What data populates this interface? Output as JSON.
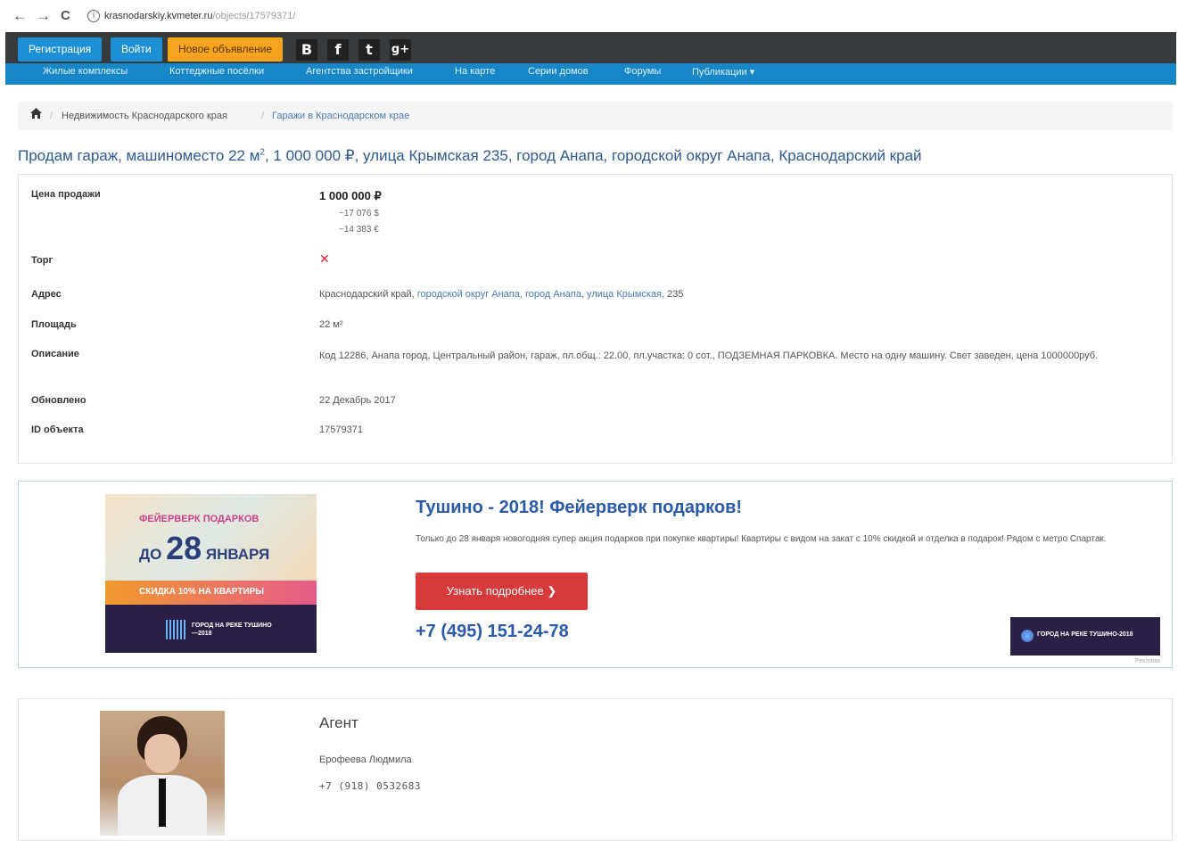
{
  "browser": {
    "back": "←",
    "forward": "→",
    "reload": "C",
    "url_host": "krasnodarskiy.kvmeter.ru",
    "url_path": "/objects/17579371/"
  },
  "header": {
    "register_label": "Регистрация",
    "login_label": "Войти",
    "new_ad_label": "Новое объявление",
    "social": [
      "B",
      "f",
      "t",
      "g+"
    ],
    "menu": [
      "Жилые комплексы",
      "Коттеджные посёлки",
      "Агентства застройщики",
      "На карте",
      "Серии домов",
      "Форумы",
      "Публикации ▾"
    ]
  },
  "breadcrumb": {
    "items": [
      "Недвижимость Краснодарского края",
      "Гаражи в Краснодарском крае"
    ]
  },
  "title": {
    "before_sup": "Продам гараж, машиноместо 22 м",
    "sup": "2",
    "after_sup": ", 1 000 000 ₽, улица Крымская 235, город Анапа, городской округ Анапа, Краснодарский край"
  },
  "details": {
    "price_label": "Цена продажи",
    "price": "1 000 000 ₽",
    "price_usd": "~17 076 $",
    "price_eur": "~14 383 €",
    "torg_label": "Торг",
    "address_label": "Адрес",
    "address_plain": "Краснодарский край,",
    "address_links": "городской округ Анапа, город Анапа, улица Крымская,",
    "address_house": "235",
    "area_label": "Площадь",
    "area": "22 м²",
    "description_label": "Описание",
    "description": "Код 12286, Анапа город, Центральный район, гараж, пл.общ.: 22.00, пл.участка: 0 сот., ПОДЗЕМНАЯ ПАРКОВКА. Место на одну машину. Свет заведен, цена 1000000руб.",
    "updated_label": "Обновлено",
    "updated": "22 Декабрь 2017",
    "id_label": "ID объекта",
    "id": "17579371"
  },
  "ad": {
    "img_line1": "ФЕЙЕРВЕРК ПОДАРКОВ",
    "img_prefix": "ДО",
    "img_number": "28",
    "img_month": "ЯНВАРЯ",
    "img_line3": "СКИДКА 10% НА КВАРТИРЫ",
    "img_logo": "ГОРОД НА РЕКЕ ТУШИНО—2018",
    "title": "Тушино - 2018! Фейерверк подарков!",
    "text": "Только до 28 января новогодняя супер акция подарков при покупке квартиры! Квартиры с видом на закат с 10% скидкой и отделка в подарок! Рядом с метро Спартак.",
    "button": "Узнать подробнее ❯",
    "phone": "+7 (495) 151-24-78",
    "small_banner": "ГОРОД НА РЕКЕ ТУШИНО-2018",
    "mark": "Реклама"
  },
  "agent": {
    "heading": "Агент",
    "name": "Ерофеева Людмила",
    "phone": "+7 (918) 0532683"
  }
}
